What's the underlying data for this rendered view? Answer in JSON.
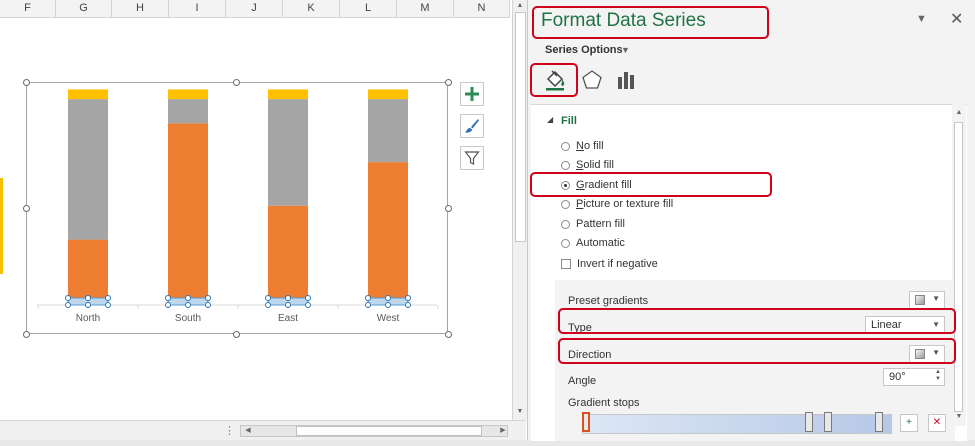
{
  "sheet": {
    "columns": [
      "F",
      "G",
      "H",
      "I",
      "J",
      "K",
      "L",
      "M",
      "N"
    ]
  },
  "chart_data": {
    "type": "bar",
    "stacked": true,
    "categories": [
      "North",
      "South",
      "East",
      "West"
    ],
    "series": [
      {
        "color": "#ed7d31",
        "values": [
          27,
          75,
          41,
          59
        ]
      },
      {
        "color": "#a5a5a5",
        "values": [
          58,
          10,
          44,
          26
        ]
      },
      {
        "color": "#ffc000",
        "values": [
          4,
          4,
          4,
          4
        ]
      }
    ],
    "ylim": [
      0,
      90
    ],
    "grid": false,
    "legend": "none",
    "selected_series_color": "#bdd7ee"
  },
  "chart_buttons": [
    {
      "icon": "plus-icon"
    },
    {
      "icon": "brush-icon"
    },
    {
      "icon": "filter-icon"
    }
  ],
  "pane": {
    "title": "Format Data Series",
    "series_options_label": "Series Options",
    "tabs": [
      {
        "icon": "paint-bucket-icon",
        "active": true
      },
      {
        "icon": "pentagon-icon",
        "active": false
      },
      {
        "icon": "bar-chart-icon",
        "active": false
      }
    ],
    "fill": {
      "heading": "Fill",
      "options": [
        {
          "key": "N",
          "rest": "o fill",
          "selected": false
        },
        {
          "key": "S",
          "rest": "olid fill",
          "selected": false
        },
        {
          "key": "G",
          "rest": "radient fill",
          "selected": true
        },
        {
          "key": "P",
          "rest": "icture or texture fill",
          "selected": false
        },
        {
          "key": "",
          "rest": "Pattern fill",
          "selected": false
        },
        {
          "key": "",
          "rest": "Automatic",
          "selected": false
        }
      ],
      "invert_label": "Invert if negative",
      "invert_checked": false
    },
    "gradient": {
      "preset_label": "Preset gradients",
      "type_label": "Type",
      "type_value": "Linear",
      "direction_label": "Direction",
      "angle_label": "Angle",
      "angle_value": "90°",
      "stops_label": "Gradient stops",
      "stops": [
        0,
        0.74,
        0.8,
        0.97
      ]
    },
    "accent_color": "#217346",
    "highlight_color": "#d0021b"
  }
}
